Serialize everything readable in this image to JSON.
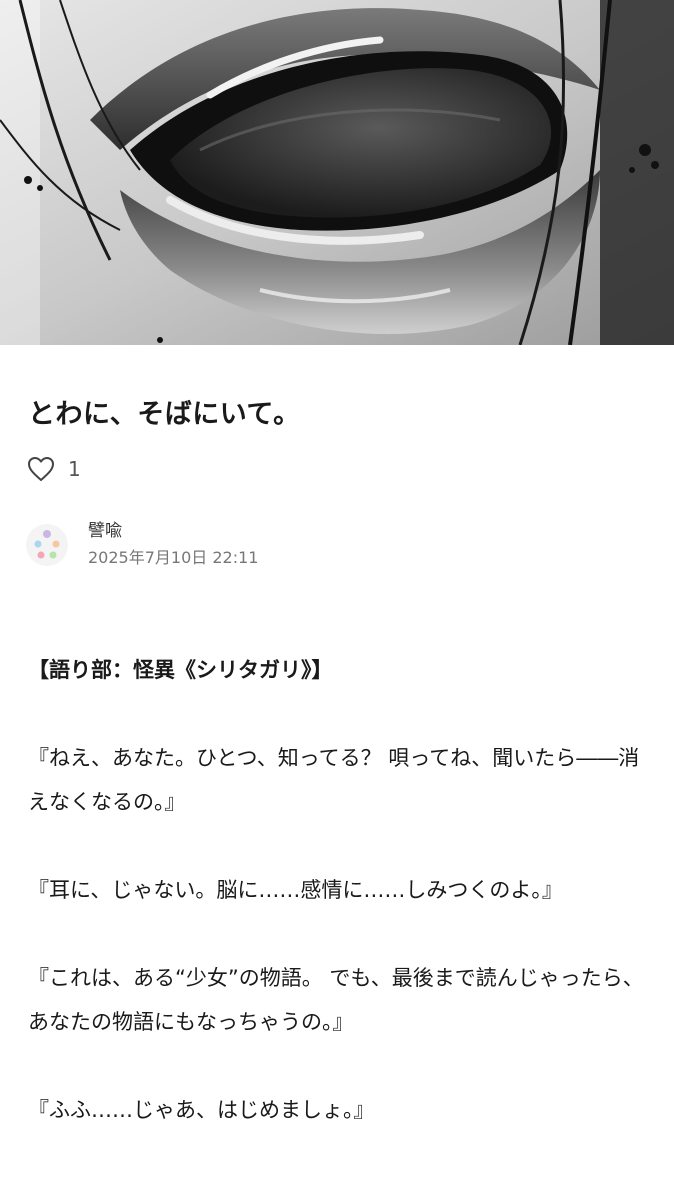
{
  "hero": {
    "icon": "header-image-illustration-lips-tongue"
  },
  "article": {
    "title": "とわに、そばにいて。",
    "like_icon": "heart-outline-icon",
    "like_count": "1"
  },
  "author": {
    "name": "譬喩",
    "date": "2025年7月10日 22:11"
  },
  "body": {
    "narrator": "【語り部：怪異《シリタガリ》】",
    "paragraphs": [
      "『ねえ、あなた。ひとつ、知ってる？ 唄ってね、聞いたら――消えなくなるの。』",
      "『耳に、じゃない。脳に……感情に……しみつくのよ。』",
      "『これは、ある“少女”の物語。 でも、最後まで読んじゃったら、あなたの物語にもなっちゃうの。』",
      "『ふふ……じゃあ、はじめましょ。』"
    ]
  }
}
